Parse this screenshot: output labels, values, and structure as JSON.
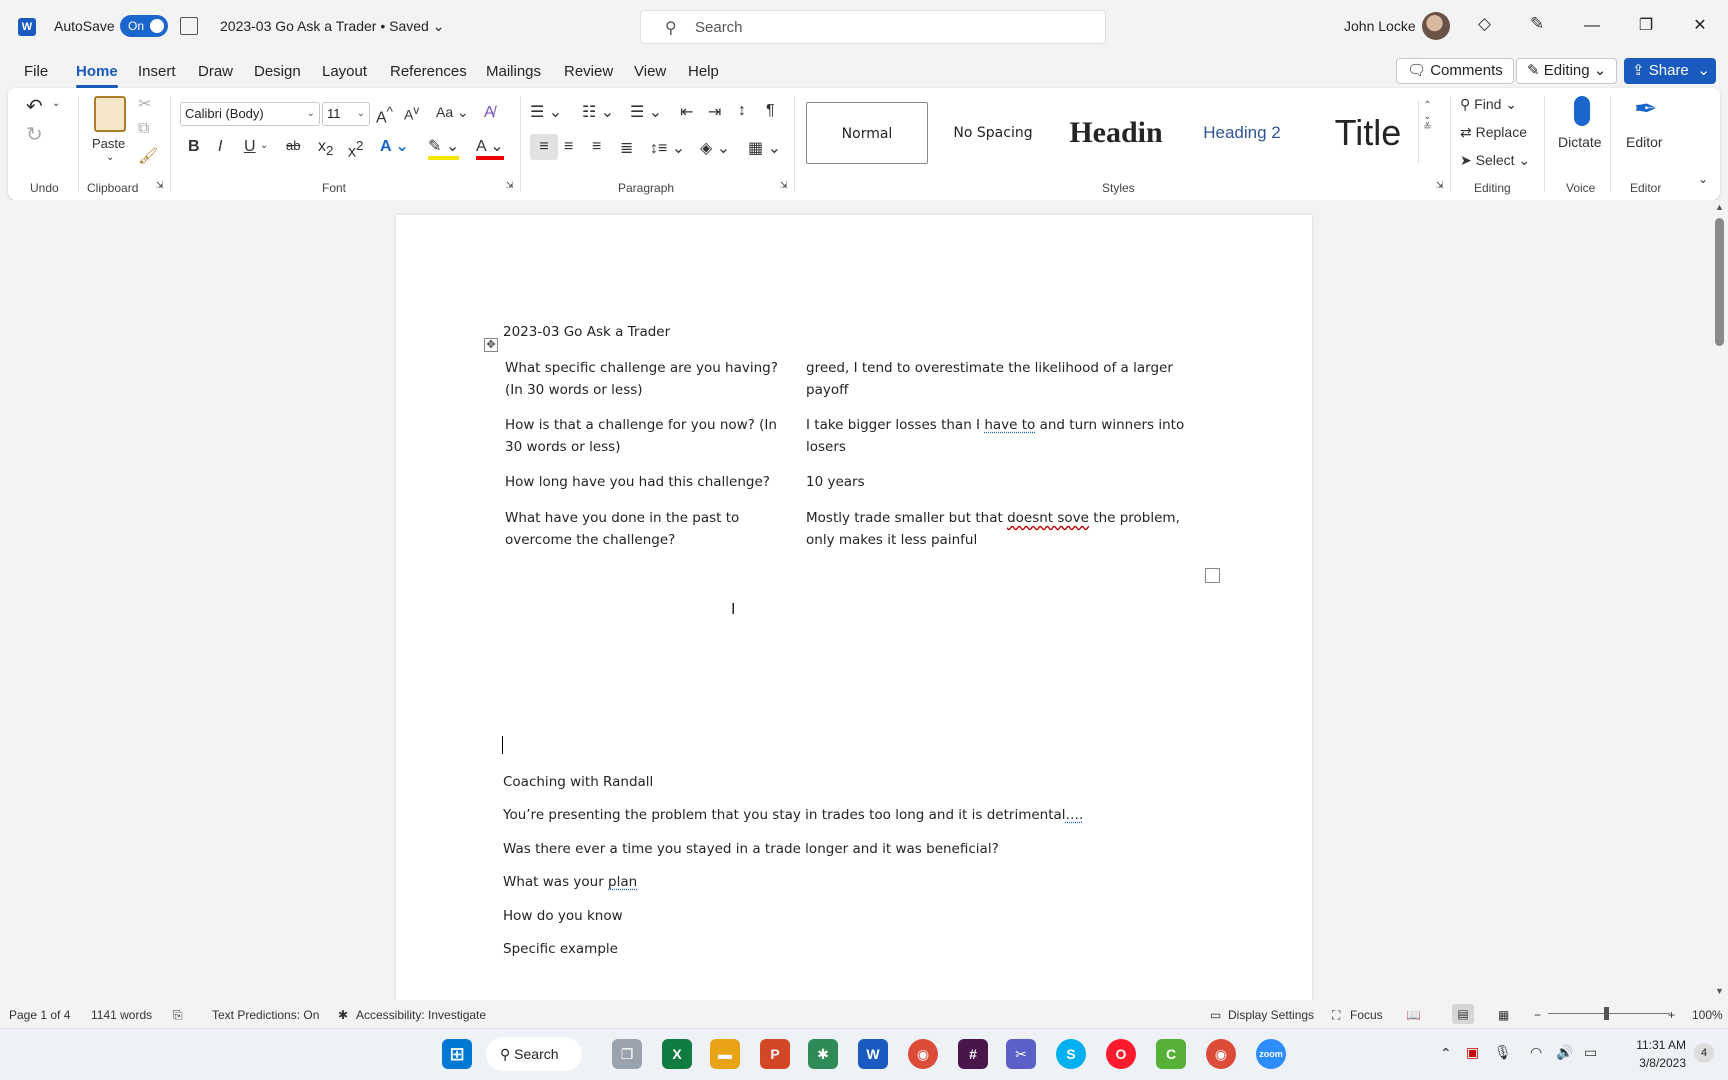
{
  "titlebar": {
    "autosave_label": "AutoSave",
    "autosave_state": "On",
    "doc_title": "2023-03 Go Ask a Trader • Saved",
    "search_placeholder": "Search",
    "user_name": "John Locke"
  },
  "menu": {
    "items": [
      "File",
      "Home",
      "Insert",
      "Draw",
      "Design",
      "Layout",
      "References",
      "Mailings",
      "Review",
      "View",
      "Help"
    ],
    "active": "Home",
    "comments_label": "Comments",
    "editing_label": "Editing",
    "share_label": "Share"
  },
  "ribbon": {
    "groups": {
      "undo": "Undo",
      "clipboard": "Clipboard",
      "font": "Font",
      "paragraph": "Paragraph",
      "styles": "Styles",
      "editing": "Editing",
      "voice": "Voice",
      "editor": "Editor"
    },
    "paste_label": "Paste",
    "font_name": "Calibri (Body)",
    "font_size": "11",
    "styles": [
      "Normal",
      "No Spacing",
      "Headin",
      "Heading 2",
      "Title"
    ],
    "find_label": "Find",
    "replace_label": "Replace",
    "select_label": "Select",
    "dictate_label": "Dictate",
    "editor_label": "Editor",
    "bold": "B",
    "italic": "I",
    "underline": "U",
    "strike": "ab",
    "change_case": "Aa"
  },
  "document": {
    "heading": "2023-03 Go Ask a Trader",
    "table": [
      {
        "q": "What specific challenge are you having? (In 30 words or less)",
        "a": "greed, I tend to overestimate the likelihood of a larger payoff"
      },
      {
        "q": "How is that a challenge for you now? (In 30 words or less)",
        "a_pre": "I take bigger losses than I ",
        "a_mark": "have to",
        "a_post": " and turn winners into losers"
      },
      {
        "q": "How long have you had this challenge?",
        "a": "10 years"
      },
      {
        "q": "What have you done in the past to overcome the challenge?",
        "a_pre": "Mostly trade smaller but that ",
        "a_mark": "doesnt sove",
        "a_post": " the problem, only makes it less painful"
      }
    ],
    "coaching_title": "Coaching with Randall",
    "line1_pre": "You’re presenting the problem that you stay in trades too long and it is detrimental",
    "line1_mark": "….",
    "line2": "Was there ever a time you stayed in a trade longer and it was beneficial?",
    "line3_pre": "What was your ",
    "line3_mark": "plan",
    "line4": "How do you know",
    "line5": "Specific example"
  },
  "status": {
    "page": "Page 1 of 4",
    "words": "1141 words",
    "predictions": "Text Predictions: On",
    "accessibility": "Accessibility: Investigate",
    "display": "Display Settings",
    "focus": "Focus",
    "zoom": "100%"
  },
  "taskbar": {
    "search_label": "Search",
    "time": "11:31 AM",
    "date": "3/8/2023",
    "notification_count": "4"
  }
}
